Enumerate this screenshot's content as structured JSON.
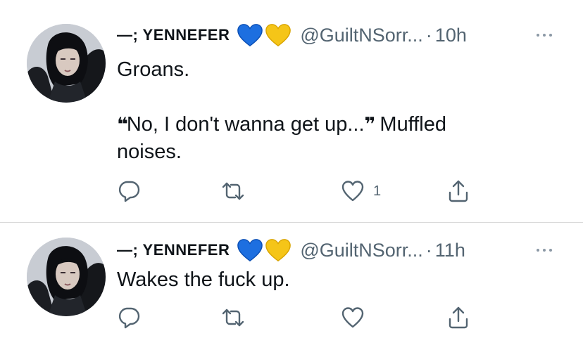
{
  "colors": {
    "blue_heart": "#1d6fe0",
    "yellow_heart": "#f5c518",
    "secondary_text": "#536471",
    "divider": "#d9d9d9"
  },
  "tweets": [
    {
      "display_name": "—; YENNEFER",
      "handle": "@GuiltNSorr...",
      "separator": "·",
      "time": "10h",
      "text_line1": "Groans.",
      "quote_open": "❝",
      "quote_text": "No, I don't wanna get up...",
      "quote_close": "❞",
      "text_after_quote": " Muffled",
      "text_line3": "noises.",
      "like_count": "1",
      "icons": [
        "reply-icon",
        "retweet-icon",
        "heart-icon",
        "share-icon"
      ]
    },
    {
      "display_name": "—; YENNEFER",
      "handle": "@GuiltNSorr...",
      "separator": "·",
      "time": "11h",
      "text_line1": "Wakes the fuck up.",
      "icons": [
        "reply-icon",
        "retweet-icon",
        "heart-icon",
        "share-icon"
      ]
    }
  ]
}
